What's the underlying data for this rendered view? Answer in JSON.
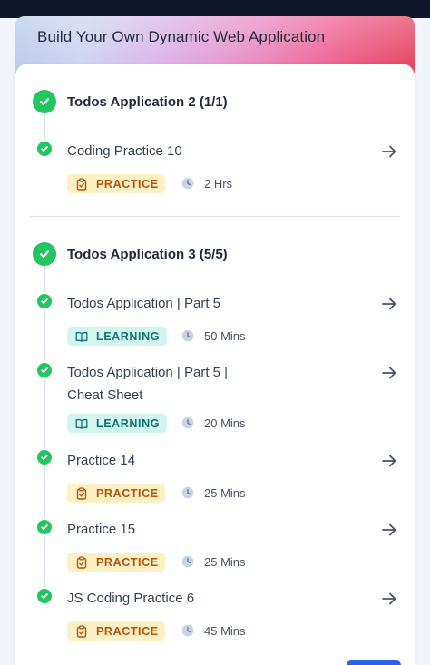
{
  "banner": {
    "title": "Build Your Own Dynamic Web Application"
  },
  "sections": [
    {
      "title": "Todos Application 2 (1/1)",
      "items": [
        {
          "title": "Coding Practice 10",
          "tag": "PRACTICE",
          "duration": "2 Hrs"
        }
      ]
    },
    {
      "title": "Todos Application 3 (5/5)",
      "items": [
        {
          "title": "Todos Application | Part 5",
          "tag": "LEARNING",
          "duration": "50 Mins"
        },
        {
          "title": "Todos Application | Part 5 | Cheat Sheet",
          "tag": "LEARNING",
          "duration": "20 Mins"
        },
        {
          "title": "Practice 14",
          "tag": "PRACTICE",
          "duration": "25 Mins"
        },
        {
          "title": "Practice 15",
          "tag": "PRACTICE",
          "duration": "25 Mins"
        },
        {
          "title": "JS Coding Practice 6",
          "tag": "PRACTICE",
          "duration": "45 Mins"
        }
      ]
    }
  ],
  "colors": {
    "complete": "#22c55e",
    "practice_bg": "#fdf0c5",
    "practice_text": "#b45309",
    "learning_bg": "#d2f5ef",
    "learning_text": "#0f766e"
  },
  "icons": {
    "complete": "check-circle-icon",
    "open": "arrow-right-icon",
    "practice": "clipboard-icon",
    "learning": "book-open-icon",
    "duration": "clock-icon"
  }
}
